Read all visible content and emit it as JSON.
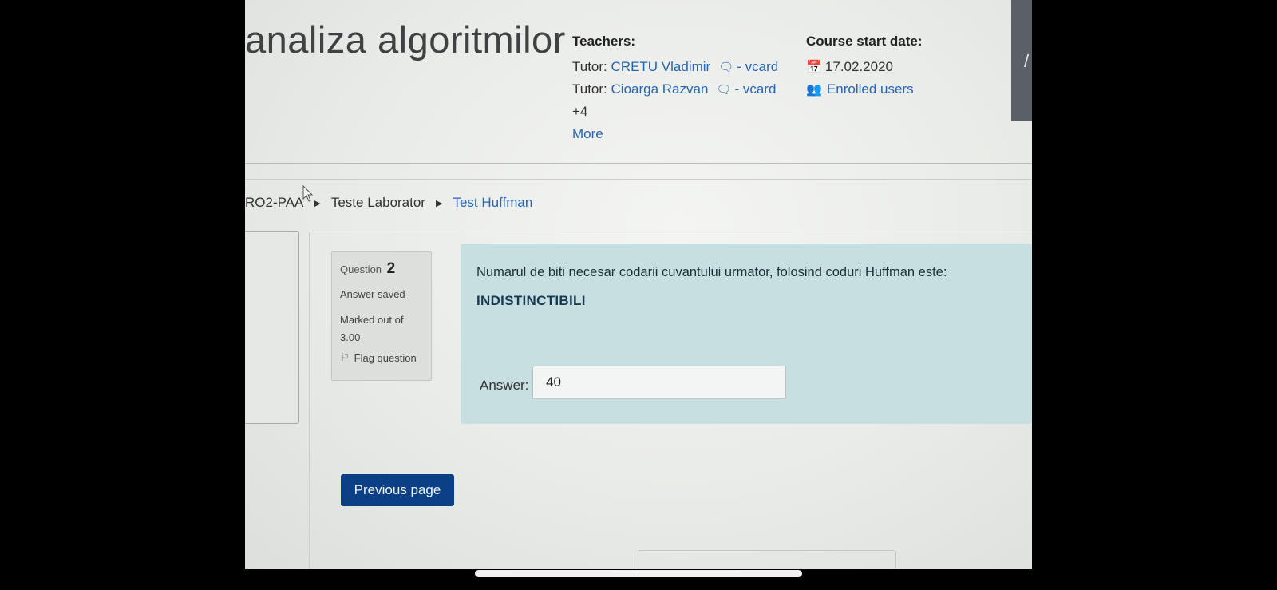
{
  "course": {
    "title": "analiza algoritmilor"
  },
  "teachers": {
    "heading": "Teachers:",
    "rows": [
      {
        "role": "Tutor:",
        "name": "CRETU Vladimir",
        "vcard": "- vcard"
      },
      {
        "role": "Tutor:",
        "name": "Cioarga Razvan",
        "vcard": "- vcard"
      }
    ],
    "extra_count": "+4",
    "more_link": "More"
  },
  "course_start": {
    "heading": "Course start date:",
    "date": "17.02.2020",
    "enrolled_link": "Enrolled users"
  },
  "breadcrumb": {
    "items": [
      "RO2-PAA",
      "Teste Laborator",
      "Test Huffman"
    ]
  },
  "question": {
    "label": "Question",
    "number": "2",
    "state": "Answer saved",
    "marked_out_of": "Marked out of",
    "mark": "3.00",
    "flag_label": "Flag question",
    "text": "Numarul de biti necesar codarii cuvantului urmator, folosind coduri Huffman este:",
    "word": "INDISTINCTIBILI",
    "answer_label": "Answer:",
    "answer_value": "40"
  },
  "navigation": {
    "previous_label": "Previous page"
  },
  "colors": {
    "link": "#2864b4",
    "question_bg": "#c7dfe0",
    "button_bg": "#0b3f86"
  },
  "icons": [
    "chat-icon",
    "calendar-icon",
    "users-icon",
    "flag-icon",
    "triangle-right-icon",
    "mouse-cursor-icon"
  ]
}
